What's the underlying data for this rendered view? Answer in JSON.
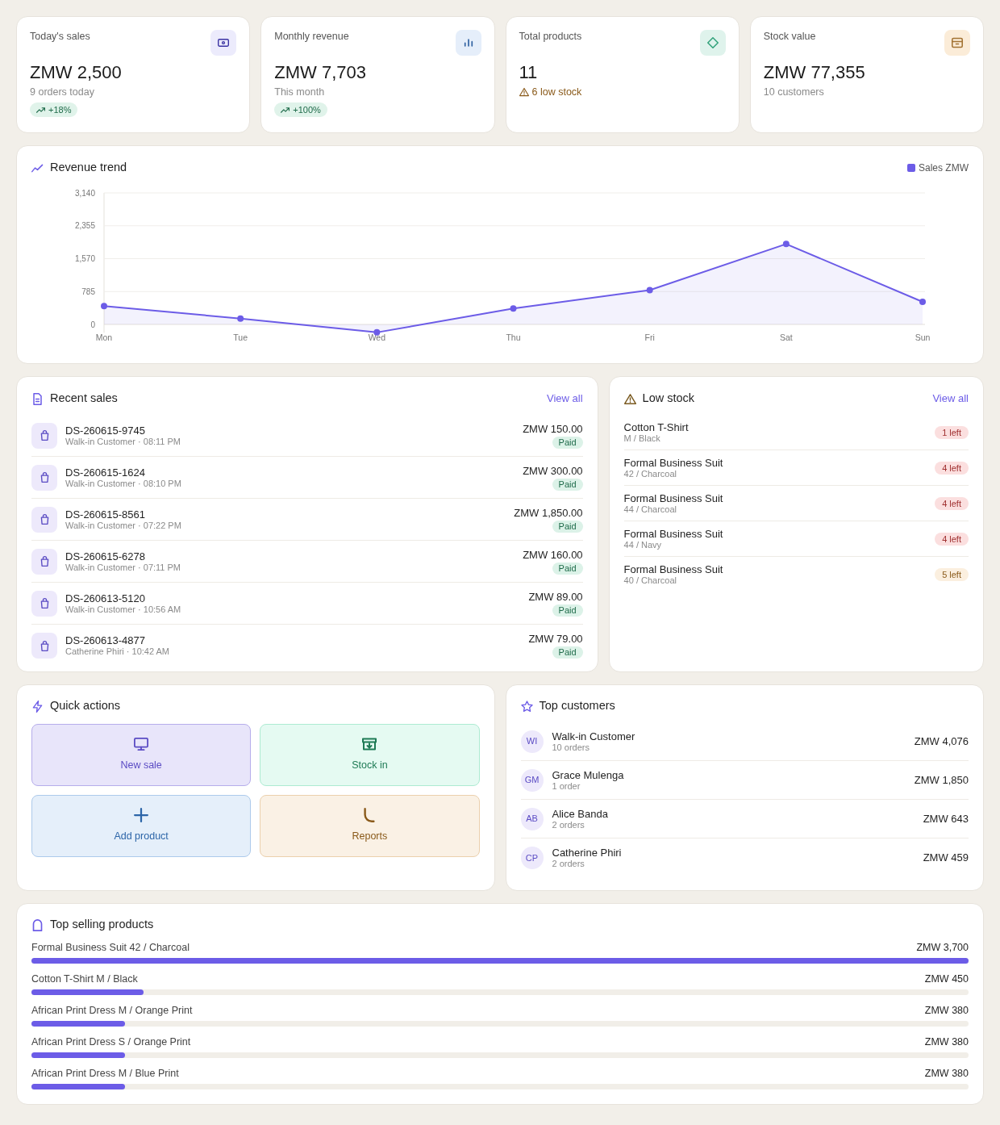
{
  "stats": [
    {
      "kind": "sales",
      "label": "Today's sales",
      "color": "#ecebfc",
      "value": "ZMW 2,500",
      "note": "9 orders today",
      "warning": false,
      "trend": "+18%"
    },
    {
      "kind": "revenue",
      "label": "Monthly revenue",
      "color": "#e5eefa",
      "value": "ZMW 7,703",
      "note": "This month",
      "warning": false,
      "trend": "+100%"
    },
    {
      "kind": "products",
      "label": "Total products",
      "color": "#dff3ec",
      "value": "11",
      "note": "6 low stock",
      "warning": true
    },
    {
      "kind": "stock",
      "label": "Stock value",
      "color": "#fbecd8",
      "value": "ZMW 77,355",
      "note": "10 customers",
      "warning": false
    }
  ],
  "revenue": {
    "chart_data": {
      "type": "area",
      "title": "Revenue trend",
      "categories": [
        "Mon",
        "Tue",
        "Wed",
        "Thu",
        "Fri",
        "Sat",
        "Sun"
      ],
      "series": [
        {
          "name": "Sales ZMW",
          "color": "#6c5ce7",
          "values": [
            440,
            140,
            -190,
            380,
            820,
            1920,
            540
          ]
        }
      ],
      "ylim": [
        -200,
        3140
      ],
      "yticks": [
        {
          "value": 0,
          "label": "0"
        },
        {
          "value": 785,
          "label": "785"
        },
        {
          "value": 1570,
          "label": "1,570"
        },
        {
          "value": 2355,
          "label": "2,355"
        },
        {
          "value": 3140,
          "label": "3,140"
        }
      ],
      "grid": true
    }
  },
  "recent_sales": {
    "title": "Recent sales",
    "link": "View all",
    "rows": [
      {
        "id": "DS-260615-9745",
        "customer": "Walk-in Customer · 08:11 PM",
        "amount": "ZMW 150.00",
        "status": "Paid"
      },
      {
        "id": "DS-260615-1624",
        "customer": "Walk-in Customer · 08:10 PM",
        "amount": "ZMW 300.00",
        "status": "Paid"
      },
      {
        "id": "DS-260615-8561",
        "customer": "Walk-in Customer · 07:22 PM",
        "amount": "ZMW 1,850.00",
        "status": "Paid"
      },
      {
        "id": "DS-260615-6278",
        "customer": "Walk-in Customer · 07:11 PM",
        "amount": "ZMW 160.00",
        "status": "Paid"
      },
      {
        "id": "DS-260613-5120",
        "customer": "Walk-in Customer · 10:56 AM",
        "amount": "ZMW 89.00",
        "status": "Paid"
      },
      {
        "id": "DS-260613-4877",
        "customer": "Catherine Phiri · 10:42 AM",
        "amount": "ZMW 79.00",
        "status": "Paid"
      }
    ]
  },
  "low_stock": {
    "title": "Low stock",
    "link": "View all",
    "rows": [
      {
        "name": "Cotton T-Shirt",
        "variant": "M / Black",
        "badge": "1 left",
        "color": "#a03030"
      },
      {
        "name": "Formal Business Suit",
        "variant": "42 / Charcoal",
        "badge": "4 left",
        "color": "#a03030"
      },
      {
        "name": "Formal Business Suit",
        "variant": "44 / Charcoal",
        "badge": "4 left",
        "color": "#a03030"
      },
      {
        "name": "Formal Business Suit",
        "variant": "44 / Navy",
        "badge": "4 left",
        "color": "#a03030"
      },
      {
        "name": "Formal Business Suit",
        "variant": "40 / Charcoal",
        "badge": "5 left",
        "color": "#8a5a1a"
      }
    ]
  },
  "quick_actions": {
    "title": "Quick actions",
    "actions": [
      {
        "kind": "sale",
        "label": "New sale",
        "color": "#5b4cc4"
      },
      {
        "kind": "stock_in",
        "label": "Stock in",
        "color": "#1e7a55"
      },
      {
        "kind": "add",
        "label": "Add product",
        "color": "#2c65a8"
      },
      {
        "kind": "reports",
        "label": "Reports",
        "color": "#8a5a1a"
      }
    ]
  },
  "top_customers": {
    "title": "Top customers",
    "rows": [
      {
        "initials": "WI",
        "name": "Walk-in Customer",
        "orders": "10 orders",
        "total": "ZMW 4,076"
      },
      {
        "initials": "GM",
        "name": "Grace Mulenga",
        "orders": "1 order",
        "total": "ZMW 1,850"
      },
      {
        "initials": "AB",
        "name": "Alice Banda",
        "orders": "2 orders",
        "total": "ZMW 643"
      },
      {
        "initials": "CP",
        "name": "Catherine Phiri",
        "orders": "2 orders",
        "total": "ZMW 459"
      }
    ]
  },
  "top_products": {
    "title": "Top selling products",
    "rows": [
      {
        "name": "Formal Business Suit 42 / Charcoal",
        "total": "ZMW 3,700",
        "level": 1
      },
      {
        "name": "Cotton T-Shirt M / Black",
        "total": "ZMW 450",
        "level": 0.12
      },
      {
        "name": "African Print Dress M / Orange Print",
        "total": "ZMW 380",
        "level": 0.1
      },
      {
        "name": "African Print Dress S / Orange Print",
        "total": "ZMW 380",
        "level": 0.1
      },
      {
        "name": "African Print Dress M / Blue Print",
        "total": "ZMW 380",
        "level": 0.1
      }
    ]
  }
}
